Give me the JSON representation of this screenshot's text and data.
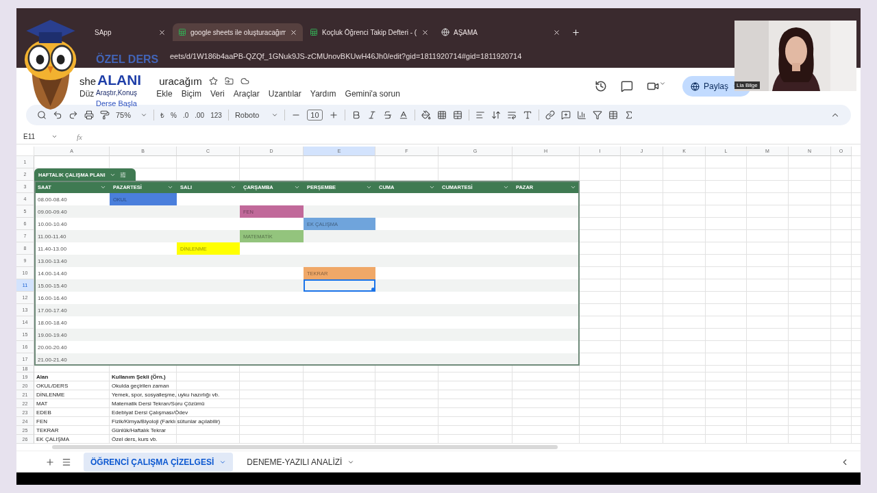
{
  "logo": {
    "lines": [
      "ÖZEL DERS",
      "ALANI",
      "Araştır,Konuş",
      "Derse Başla"
    ]
  },
  "webcam": {
    "kind": "picture",
    "name_tag": "Lia Bilge"
  },
  "browser": {
    "tabs": [
      {
        "label": "SApp",
        "kind": "plain",
        "selected": false
      },
      {
        "label": "google sheets ile oluşturacağım",
        "kind": "sheet",
        "selected": true
      },
      {
        "label": "Koçluk Öğrenci Takip Defteri - (",
        "kind": "sheet",
        "selected": false
      },
      {
        "label": "AŞAMA",
        "kind": "web",
        "selected": false
      }
    ],
    "url": "eets/d/1W186b4aaPB-QZQf_1GNuk9JS-zCMUnovBKUwH46Jh0/edit?gid=1811920714#gid=1811920714"
  },
  "doc": {
    "title_parts": [
      "she",
      "uracağım"
    ],
    "menu": [
      "Düz",
      "Ekle",
      "Biçim",
      "Veri",
      "Araçlar",
      "Uzantılar",
      "Yardım",
      "Gemini'a sorun"
    ],
    "share": "Paylaş"
  },
  "toolbar": {
    "zoom": "75%",
    "currency": "₺",
    "percent": "%",
    "decimal_decrease": ".0",
    "decimal_increase": ".00",
    "number_format": "123",
    "font": "Roboto",
    "font_size": "10"
  },
  "formula_bar": {
    "name_box": "E11",
    "fx": "fx"
  },
  "grid": {
    "columns": [
      {
        "label": "A",
        "selected": false
      },
      {
        "label": "B",
        "selected": false
      },
      {
        "label": "C",
        "selected": false
      },
      {
        "label": "D",
        "selected": false
      },
      {
        "label": "E",
        "selected": true
      },
      {
        "label": "F",
        "selected": false
      },
      {
        "label": "G",
        "selected": false
      },
      {
        "label": "H",
        "selected": false
      },
      {
        "label": "I",
        "selected": false
      },
      {
        "label": "J",
        "selected": false
      },
      {
        "label": "K",
        "selected": false
      },
      {
        "label": "L",
        "selected": false
      },
      {
        "label": "M",
        "selected": false
      },
      {
        "label": "N",
        "selected": false
      },
      {
        "label": "O",
        "selected": false
      }
    ],
    "rows": [
      {
        "label": "1",
        "selected": false
      },
      {
        "label": "2",
        "selected": false
      },
      {
        "label": "3",
        "selected": false
      },
      {
        "label": "4",
        "selected": false
      },
      {
        "label": "5",
        "selected": false
      },
      {
        "label": "6",
        "selected": false
      },
      {
        "label": "7",
        "selected": false
      },
      {
        "label": "8",
        "selected": false
      },
      {
        "label": "9",
        "selected": false
      },
      {
        "label": "10",
        "selected": false
      },
      {
        "label": "11",
        "selected": true
      },
      {
        "label": "12",
        "selected": false
      },
      {
        "label": "13",
        "selected": false
      },
      {
        "label": "14",
        "selected": false
      },
      {
        "label": "15",
        "selected": false
      },
      {
        "label": "16",
        "selected": false
      },
      {
        "label": "17",
        "selected": false
      },
      {
        "label": "18",
        "selected": false
      },
      {
        "label": "19",
        "selected": false
      },
      {
        "label": "20",
        "selected": false
      },
      {
        "label": "21",
        "selected": false
      },
      {
        "label": "22",
        "selected": false
      },
      {
        "label": "23",
        "selected": false
      },
      {
        "label": "24",
        "selected": false
      },
      {
        "label": "25",
        "selected": false
      },
      {
        "label": "26",
        "selected": false
      }
    ]
  },
  "plan": {
    "title": "HAFTALIK ÇALIŞMA PLANI",
    "headers": [
      "SAAT",
      "PAZARTESİ",
      "SALI",
      "ÇARŞAMBA",
      "PERŞEMBE",
      "CUMA",
      "CUMARTESİ",
      "PAZAR"
    ],
    "rows": [
      {
        "time": "08.00-08.40",
        "cells": [
          {
            "text": "OKUL",
            "color": "#4a7fdc"
          },
          null,
          null,
          null,
          null,
          null,
          null
        ]
      },
      {
        "time": "09.00-09.40",
        "cells": [
          null,
          null,
          {
            "text": "FEN",
            "color": "#c1699a"
          },
          null,
          null,
          null,
          null
        ]
      },
      {
        "time": "10.00-10.40",
        "cells": [
          null,
          null,
          null,
          {
            "text": "EK ÇALIŞMA",
            "color": "#6fa4dc"
          },
          null,
          null,
          null
        ]
      },
      {
        "time": "11.00-11.40",
        "cells": [
          null,
          null,
          {
            "text": "MATEMATİK",
            "color": "#93c47d"
          },
          null,
          null,
          null,
          null
        ]
      },
      {
        "time": "11.40-13.00",
        "cells": [
          null,
          {
            "text": "DİNLENME",
            "color": "#ffff00"
          },
          null,
          null,
          null,
          null,
          null
        ]
      },
      {
        "time": "13.00-13.40",
        "cells": [
          null,
          null,
          null,
          null,
          null,
          null,
          null
        ]
      },
      {
        "time": "14.00-14.40",
        "cells": [
          null,
          null,
          null,
          {
            "text": "TEKRAR",
            "color": "#f0a868"
          },
          null,
          null,
          null
        ]
      },
      {
        "time": "15.00-15.40",
        "cells": [
          null,
          null,
          null,
          null,
          null,
          null,
          null
        ]
      },
      {
        "time": "16.00-16.40",
        "cells": [
          null,
          null,
          null,
          null,
          null,
          null,
          null
        ]
      },
      {
        "time": "17.00-17.40",
        "cells": [
          null,
          null,
          null,
          null,
          null,
          null,
          null
        ]
      },
      {
        "time": "18.00-18.40",
        "cells": [
          null,
          null,
          null,
          null,
          null,
          null,
          null
        ]
      },
      {
        "time": "19.00-19.40",
        "cells": [
          null,
          null,
          null,
          null,
          null,
          null,
          null
        ]
      },
      {
        "time": "20.00-20.40",
        "cells": [
          null,
          null,
          null,
          null,
          null,
          null,
          null
        ]
      },
      {
        "time": "21.00-21.40",
        "cells": [
          null,
          null,
          null,
          null,
          null,
          null,
          null
        ]
      }
    ]
  },
  "legend": {
    "header": [
      "Alan",
      "Kullanım Şekli (Örn.)"
    ],
    "rows": [
      [
        "OKUL/DERS",
        "Okulda geçirilen zaman"
      ],
      [
        "DİNLENME",
        "Yemek, spor, sosyalleşme, uyku hazırlığı vb."
      ],
      [
        "MAT",
        "Matematik Dersi Tekrarı/Soru Çözümü"
      ],
      [
        "EDEB",
        "Edebiyat Dersi Çalışması/Ödev"
      ],
      [
        "FEN",
        "Fizik/Kimya/Biyoloji (Farklı sütunlar açılabilir)"
      ],
      [
        "TEKRAR",
        "Günlük/Haftalık Tekrar"
      ],
      [
        "EK ÇALIŞMA",
        "Özel ders, kurs vb."
      ]
    ]
  },
  "sheet_tabs": [
    {
      "label": "ÖĞRENCİ ÇALIŞMA ÇİZELGESİ",
      "selected": true
    },
    {
      "label": "DENEME-YAZILI ANALİZİ",
      "selected": false
    }
  ]
}
